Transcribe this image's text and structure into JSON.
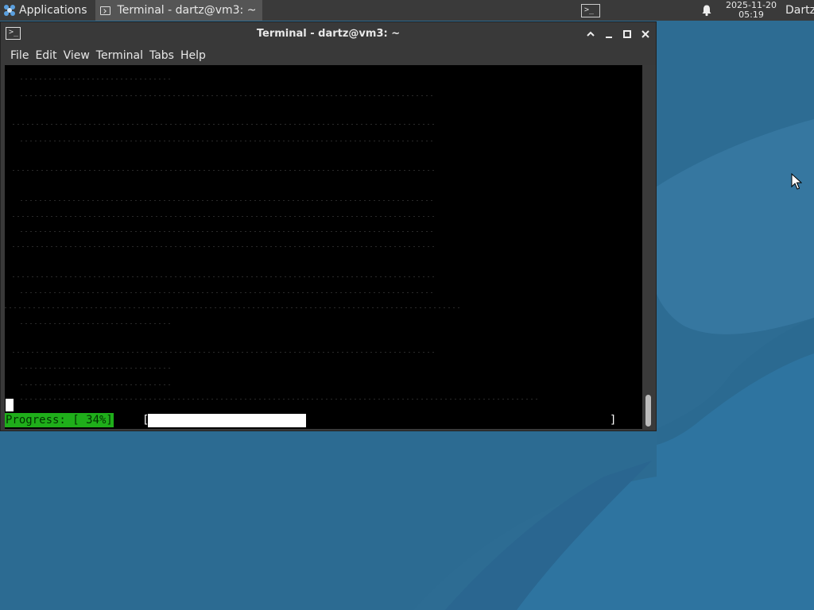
{
  "panel": {
    "apps_label": "Applications",
    "task_title": "Terminal - dartz@vm3: ~",
    "clock_date": "2025-11-20",
    "clock_time": "05:19",
    "user": "Dartz"
  },
  "window": {
    "title": "Terminal - dartz@vm3: ~",
    "menus": [
      "File",
      "Edit",
      "View",
      "Terminal",
      "Tabs",
      "Help"
    ]
  },
  "terminal": {
    "progress_label": "Progress: [ 34%]",
    "progress_fraction": 0.34,
    "bracket_open": "[",
    "bracket_close": "]"
  },
  "colors": {
    "desktop": "#2f6e95",
    "progress_green": "#1fae1a"
  },
  "icons": {
    "apps": "xfce-mouse-icon",
    "terminal": "terminal-icon",
    "bell": "bell-icon"
  }
}
